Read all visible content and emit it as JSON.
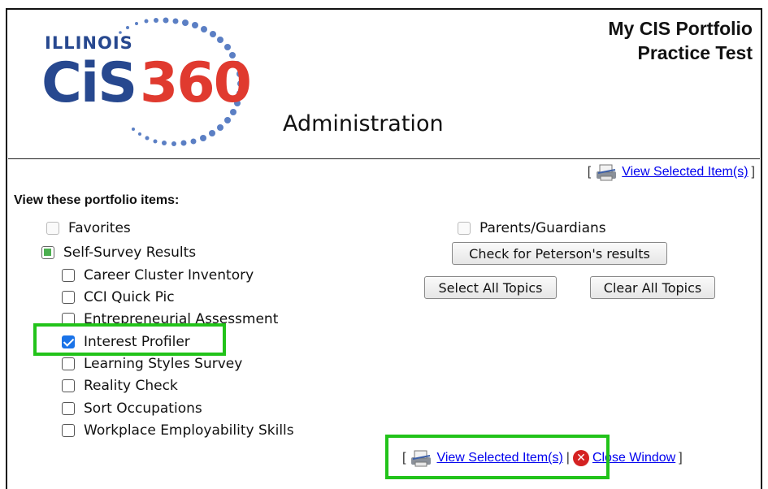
{
  "header": {
    "logo_state": "ILLINOIS",
    "logo_brand": "CiS",
    "logo_number": "360",
    "subtitle": "Administration",
    "title_line1": "My CIS Portfolio",
    "title_line2": "Practice Test"
  },
  "top_links": {
    "open_bracket": "[",
    "view_selected": "View Selected Item(s)",
    "close_bracket": "]"
  },
  "section": {
    "heading": "View these portfolio items:"
  },
  "left_items": {
    "favorites": {
      "label": "Favorites",
      "state": "disabled"
    },
    "self_survey": {
      "label": "Self-Survey Results",
      "state": "partial"
    },
    "sub_items": [
      {
        "label": "Career Cluster Inventory",
        "checked": false
      },
      {
        "label": "CCI Quick Pic",
        "checked": false
      },
      {
        "label": "Entrepreneurial Assessment",
        "checked": false
      },
      {
        "label": "Interest Profiler",
        "checked": true
      },
      {
        "label": "Learning Styles Survey",
        "checked": false
      },
      {
        "label": "Reality Check",
        "checked": false
      },
      {
        "label": "Sort Occupations",
        "checked": false
      },
      {
        "label": "Workplace Employability Skills",
        "checked": false
      }
    ]
  },
  "right_items": {
    "parents": {
      "label": "Parents/Guardians",
      "state": "disabled"
    },
    "peterson_button": "Check for Peterson's results",
    "select_all_button": "Select All Topics",
    "clear_all_button": "Clear All Topics"
  },
  "bottom_links": {
    "open_bracket": "[",
    "view_selected": "View Selected Item(s)",
    "separator": "|",
    "close_window": "Close Window",
    "close_bracket": "]"
  },
  "colors": {
    "highlight": "#22c31a",
    "link": "#0000ee",
    "logo_blue": "#27488f",
    "logo_red": "#e03a2f",
    "check_blue": "#1a73e8"
  },
  "icons": {
    "printer": "printer-icon",
    "close": "close-x-icon"
  }
}
